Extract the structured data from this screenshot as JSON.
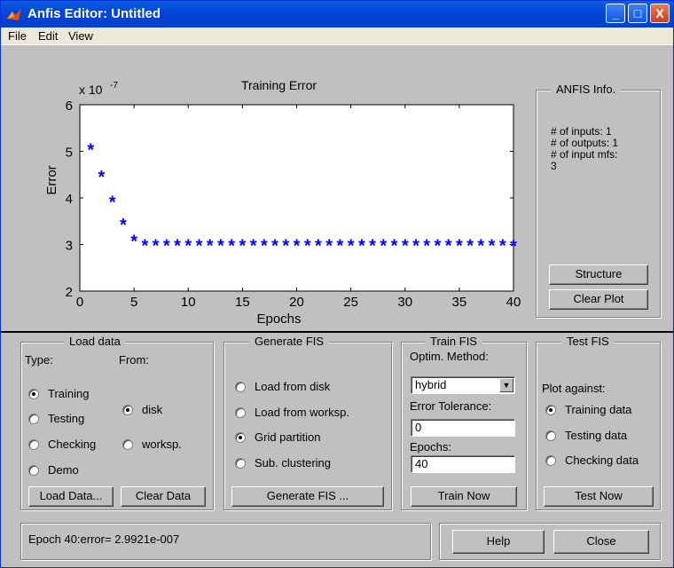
{
  "window": {
    "title": "Anfis Editor: Untitled",
    "min_glyph": "_",
    "max_glyph": "□",
    "close_glyph": "X"
  },
  "menu": {
    "items": [
      "File",
      "Edit",
      "View"
    ]
  },
  "chart_data": {
    "type": "scatter",
    "title": "Training Error",
    "xlabel": "Epochs",
    "ylabel": "Error",
    "scale_label": "x 10",
    "scale_exp": "-7",
    "xlim": [
      0,
      40
    ],
    "ylim": [
      2,
      6
    ],
    "xticks": [
      "0",
      "5",
      "10",
      "15",
      "20",
      "25",
      "30",
      "35",
      "40"
    ],
    "yticks": [
      "2",
      "3",
      "4",
      "5",
      "6"
    ],
    "marker": "*",
    "marker_color": "#0000ff",
    "x": [
      1,
      2,
      3,
      4,
      5,
      6,
      7,
      8,
      9,
      10,
      11,
      12,
      13,
      14,
      15,
      16,
      17,
      18,
      19,
      20,
      21,
      22,
      23,
      24,
      25,
      26,
      27,
      28,
      29,
      30,
      31,
      32,
      33,
      34,
      35,
      36,
      37,
      38,
      39,
      40
    ],
    "y": [
      5.06,
      4.48,
      3.93,
      3.45,
      3.1,
      3.0,
      3.0,
      3.0,
      3.0,
      3.0,
      3.0,
      3.0,
      3.0,
      3.0,
      3.0,
      3.0,
      3.0,
      3.0,
      3.0,
      3.0,
      3.0,
      3.0,
      3.0,
      3.0,
      3.0,
      3.0,
      3.0,
      3.0,
      3.0,
      3.0,
      3.0,
      3.0,
      3.0,
      3.0,
      3.0,
      3.0,
      3.0,
      3.0,
      3.0,
      2.99
    ]
  },
  "anfis_info": {
    "title": "ANFIS Info.",
    "lines": [
      "# of inputs: 1",
      "# of outputs: 1",
      "# of input mfs:",
      "3"
    ],
    "structure_button": "Structure",
    "clear_plot_button": "Clear Plot"
  },
  "load_data": {
    "title": "Load data",
    "type_label": "Type:",
    "from_label": "From:",
    "types": [
      "Training",
      "Testing",
      "Checking",
      "Demo"
    ],
    "selected_type": "Training",
    "sources": [
      "disk",
      "worksp."
    ],
    "selected_source": "disk",
    "load_button": "Load Data...",
    "clear_button": "Clear Data"
  },
  "generate_fis": {
    "title": "Generate FIS",
    "options": [
      "Load from disk",
      "Load from worksp.",
      "Grid partition",
      "Sub. clustering"
    ],
    "selected": "Grid partition",
    "button": "Generate FIS ..."
  },
  "train_fis": {
    "title": "Train FIS",
    "method_label": "Optim. Method:",
    "method_value": "hybrid",
    "tolerance_label": "Error Tolerance:",
    "tolerance_value": "0",
    "epochs_label": "Epochs:",
    "epochs_value": "40",
    "button": "Train Now"
  },
  "test_fis": {
    "title": "Test FIS",
    "plot_against_label": "Plot against:",
    "options": [
      "Training data",
      "Testing data",
      "Checking data"
    ],
    "selected": "Training data",
    "button": "Test Now"
  },
  "status": {
    "text": "Epoch 40:error= 2.9921e-007"
  },
  "footer": {
    "help_button": "Help",
    "close_button": "Close"
  }
}
